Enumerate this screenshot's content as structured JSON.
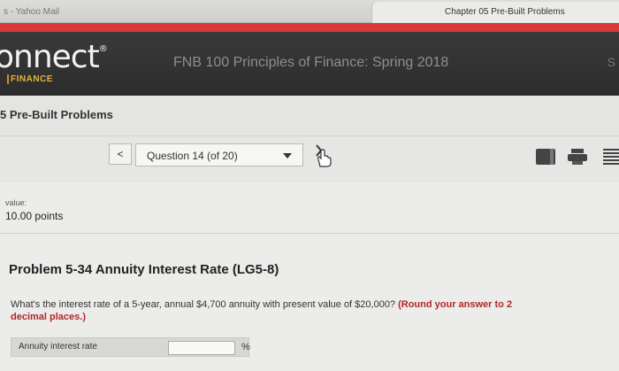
{
  "browser": {
    "tab_left": "s - Yahoo Mail",
    "tab_right": "Chapter 05 Pre-Built Problems"
  },
  "header": {
    "logo_text": "onnect",
    "logo_registered": "®",
    "logo_sub": "FINANCE",
    "course_title": "FNB 100 Principles of Finance: Spring 2018",
    "user_initial": "S"
  },
  "assignment": {
    "title": "5 Pre-Built Problems"
  },
  "nav": {
    "prev_label": "<",
    "question_selector": "Question 14 (of 20)",
    "next_label": "›",
    "tools": [
      "book-icon",
      "print-icon",
      "list-icon"
    ]
  },
  "question": {
    "value_label": "value:",
    "points": "10.00 points",
    "problem_title": "Problem 5-34 Annuity Interest Rate (LG5-8)",
    "text": "What's the interest rate of a 5-year, annual $4,700 annuity with present value of $20,000? ",
    "round_note": "(Round your answer to 2 decimal places.)",
    "answer_label": "Annuity interest rate",
    "answer_value": "",
    "answer_unit": "%"
  },
  "colors": {
    "accent_red": "#d7393b",
    "brand_dark": "#2c2c2c",
    "brand_gold": "#e6b33b",
    "note_red": "#b0282a"
  }
}
